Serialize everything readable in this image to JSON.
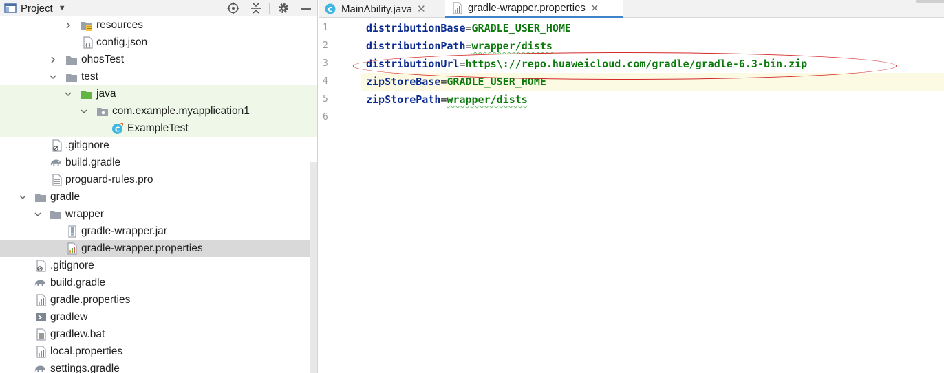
{
  "project_panel": {
    "title": "Project",
    "tree": [
      {
        "label": "resources",
        "icon": "folder-resources-icon",
        "expanded": false
      },
      {
        "label": "config.json",
        "icon": "json-file-icon"
      },
      {
        "label": "ohosTest",
        "icon": "folder-icon",
        "expanded": false
      },
      {
        "label": "test",
        "icon": "folder-icon",
        "expanded": true
      },
      {
        "label": "java",
        "icon": "test-source-folder-icon",
        "expanded": true
      },
      {
        "label": "com.example.myapplication1",
        "icon": "package-icon",
        "expanded": true
      },
      {
        "label": "ExampleTest",
        "icon": "java-class-icon"
      },
      {
        "label": ".gitignore",
        "icon": "gitignore-file-icon"
      },
      {
        "label": "build.gradle",
        "icon": "gradle-elephant-icon"
      },
      {
        "label": "proguard-rules.pro",
        "icon": "text-file-icon"
      },
      {
        "label": "gradle",
        "icon": "folder-icon",
        "expanded": true
      },
      {
        "label": "wrapper",
        "icon": "folder-icon",
        "expanded": true
      },
      {
        "label": "gradle-wrapper.jar",
        "icon": "jar-file-icon"
      },
      {
        "label": "gradle-wrapper.properties",
        "icon": "properties-file-icon"
      },
      {
        "label": ".gitignore",
        "icon": "gitignore-file-icon"
      },
      {
        "label": "build.gradle",
        "icon": "gradle-elephant-icon"
      },
      {
        "label": "gradle.properties",
        "icon": "properties-file-icon"
      },
      {
        "label": "gradlew",
        "icon": "shell-script-icon"
      },
      {
        "label": "gradlew.bat",
        "icon": "text-file-icon"
      },
      {
        "label": "local.properties",
        "icon": "properties-file-icon"
      },
      {
        "label": "settings.gradle",
        "icon": "gradle-elephant-icon"
      }
    ]
  },
  "editor": {
    "tabs": [
      {
        "label": "MainAbility.java",
        "icon": "java-class-icon",
        "active": false
      },
      {
        "label": "gradle-wrapper.properties",
        "icon": "properties-file-icon",
        "active": true
      }
    ],
    "lines": [
      {
        "num": "1",
        "key": "distributionBase",
        "value": "GRADLE_USER_HOME"
      },
      {
        "num": "2",
        "key": "distributionPath",
        "value": "wrapper/dists"
      },
      {
        "num": "3",
        "key": "distributionUrl",
        "value": "https\\://repo.huaweicloud.com/gradle/gradle-6.3-bin.zip"
      },
      {
        "num": "4",
        "key": "zipStoreBase",
        "value": "GRADLE_USER_HOME"
      },
      {
        "num": "5",
        "key": "zipStorePath",
        "value": "wrapper/dists"
      },
      {
        "num": "6",
        "key": "",
        "value": ""
      }
    ]
  },
  "colors": {
    "key": "#0a2a8f",
    "value": "#0a7a0a",
    "annotation": "#d42b2b",
    "tab_active_underline": "#4083c9",
    "selection": "#d9d9d9",
    "test_tint": "#eef7e8"
  }
}
